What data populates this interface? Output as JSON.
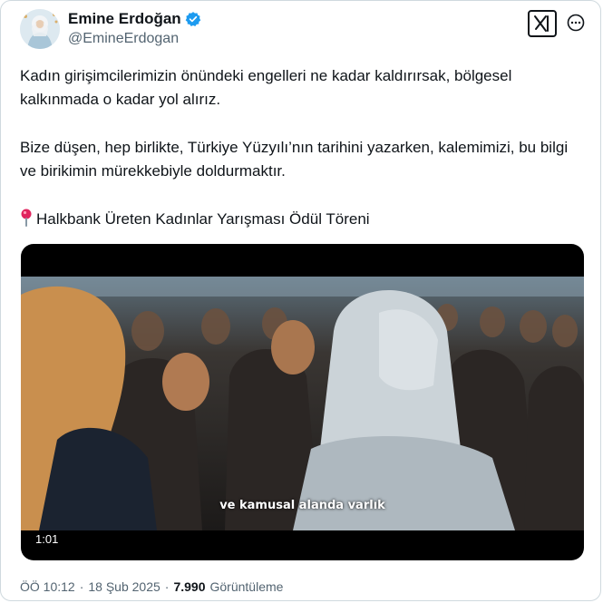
{
  "author": {
    "name": "Emine Erdoğan",
    "handle": "@EmineErdogan",
    "verified": true,
    "avatar_icon": "avatar-photo"
  },
  "header": {
    "logo_icon": "x-logo-icon",
    "more_icon": "more-options-icon"
  },
  "tweet": {
    "paragraph_1": "Kadın girişimcilerimizin önündeki engelleri ne kadar kaldırırsak, bölgesel kalkınmada o kadar yol alırız.",
    "paragraph_2": "Bize düşen, hep birlikte, Türkiye Yüzyılı’nın tarihini yazarken, kalemimizi, bu bilgi ve birikimin mürekkebiyle doldurmaktır.",
    "paragraph_3": "Halkbank Üreten Kadınlar Yarışması Ödül Töreni",
    "pin_icon": "round-pushpin-icon"
  },
  "video": {
    "caption": "ve kamusal alanda varlık",
    "duration": "1:01"
  },
  "meta": {
    "time": "ÖÖ 10:12",
    "separator": "·",
    "date": "18 Şub 2025",
    "views_count": "7.990",
    "views_label": "Görüntüleme"
  },
  "colors": {
    "text": "#0f1419",
    "muted": "#536471",
    "verified": "#1d9bf0",
    "border": "#cfd9de",
    "pin": "#e0245e"
  }
}
